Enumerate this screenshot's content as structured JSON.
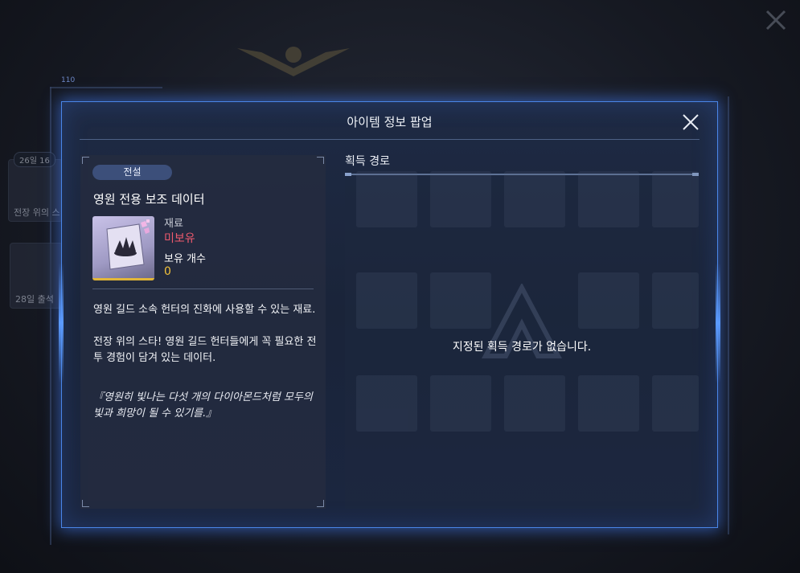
{
  "background": {
    "cards": [
      {
        "badge": "26일 16",
        "label": "전장 위의 스"
      },
      {
        "label": "28일 출석"
      }
    ],
    "tag": "110"
  },
  "popup": {
    "title": "아이템 정보 팝업",
    "item": {
      "rarity": "전설",
      "name": "영원 전용 보조 데이터",
      "type": "재료",
      "owned_status": "미보유",
      "count_label": "보유 개수",
      "count": "0",
      "description": [
        "영원 길드 소속 헌터의 진화에 사용할 수 있는 재료.",
        "전장 위의 스타! 영원 길드 헌터들에게 꼭 필요한 전투 경험이 담겨 있는 데이터."
      ],
      "quote": "『영원히 빛나는 다섯 개의 다이아몬드처럼 모두의 빛과 희망이 될 수 있기를.』"
    },
    "acquisition": {
      "title": "획득 경로",
      "empty_message": "지정된 획득 경로가 없습니다."
    }
  },
  "colors": {
    "accent": "#4a86e8",
    "not_owned": "#ef5a6e",
    "count": "#f2c23a",
    "legendary_border": "#e2b638"
  },
  "icons": {
    "close": "close-icon",
    "item": "shattered-card-icon"
  }
}
